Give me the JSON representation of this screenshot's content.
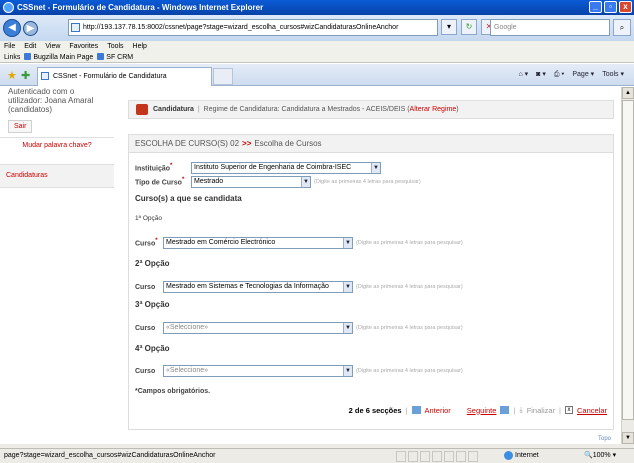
{
  "window": {
    "title": "CSSnet - Formulário de Candidatura - Windows Internet Explorer",
    "min": "_",
    "max": "▫",
    "close": "x"
  },
  "address_bar": {
    "url": "http://193.137.78.15:8002/cssnet/page?stage=wizard_escolha_cursos#wizCandidaturasOnlineAnchor",
    "search_placeholder": "Google"
  },
  "menu": [
    "File",
    "Edit",
    "View",
    "Favorites",
    "Tools",
    "Help"
  ],
  "links": {
    "label": "Links",
    "items": [
      "Bugzilla Main Page",
      "SF CRM"
    ]
  },
  "tab": {
    "title": "CSSnet - Formulário de Candidatura"
  },
  "command_bar": {
    "page": "Page",
    "tools": "Tools"
  },
  "sidebar": {
    "auth_line1": "Autenticado com o",
    "auth_line2": "utilizador: Joana Amaral",
    "auth_line3": "(candidatos)",
    "logout": "Sair",
    "change_password": "Mudar palavra chave?",
    "candidaturas": "Candidaturas"
  },
  "breadcrumb": {
    "section": "Candidatura",
    "regime_label": "Regime de Candidatura:",
    "regime_value": "Candidatura a Mestrados - ACEIS/DEIS",
    "alter_prefix": "(",
    "alter_link": "Alterar Regime",
    "alter_suffix": ")"
  },
  "form": {
    "heading_prefix": "ESCOLHA DE CURSO(S) 02",
    "heading_arrow": ">>",
    "heading_suffix": "Escolha de Cursos",
    "instituicao_label": "Instituição",
    "instituicao_value": "Instituto Superior de Engenharia de Coimbra-ISEC",
    "tipo_label": "Tipo de Curso",
    "tipo_value": "Mestrado",
    "hint": "(Digite as primeiras 4 letras para pesquisar)",
    "cursos_heading": "Curso(s) a que se candidata",
    "curso_label": "Curso",
    "required_mark": "*",
    "options": [
      {
        "title": "1ª Opção",
        "value": "Mestrado em Comércio Electrónico",
        "required": true
      },
      {
        "title": "2ª Opção",
        "value": "Mestrado em Sistemas e Tecnologias da Informação",
        "required": false
      },
      {
        "title": "3ª Opção",
        "value": "«Seleccione»",
        "required": false
      },
      {
        "title": "4ª Opção",
        "value": "«Seleccione»",
        "required": false
      }
    ],
    "required_note": "*Campos obrigatórios."
  },
  "pager": {
    "count": "2 de 6 secções",
    "previous": "Anterior",
    "next": "Seguinte",
    "finish": "Finalizar",
    "cancel": "Cancelar"
  },
  "topo": "Topo",
  "status": {
    "text": "page?stage=wizard_escolha_cursos#wizCandidaturasOnlineAnchor",
    "zone": "Internet",
    "zoom": "100%"
  },
  "colors": {
    "accent_red": "#cc0000",
    "titlebar_blue": "#0a5bd6"
  }
}
